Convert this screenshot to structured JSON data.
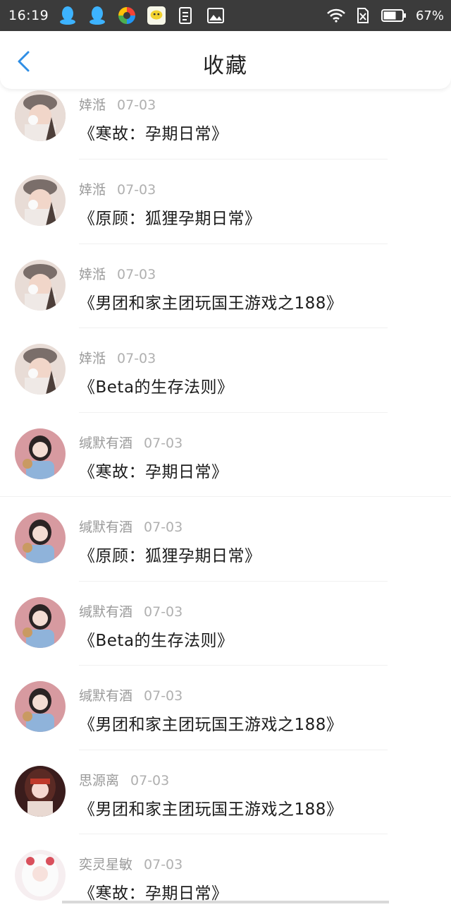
{
  "status": {
    "time": "16:19",
    "battery": "67%"
  },
  "header": {
    "title": "收藏"
  },
  "items": [
    {
      "author": "婞湉",
      "date": "07-03",
      "title": "《寒故：孕期日常》",
      "avatar": "girl-hat"
    },
    {
      "author": "婞湉",
      "date": "07-03",
      "title": "《原顾：狐狸孕期日常》",
      "avatar": "girl-hat"
    },
    {
      "author": "婞湉",
      "date": "07-03",
      "title": "《男团和家主团玩国王游戏之188》",
      "avatar": "girl-hat"
    },
    {
      "author": "婞湉",
      "date": "07-03",
      "title": "《Beta的生存法则》",
      "avatar": "girl-hat"
    },
    {
      "author": "缄默有酒",
      "date": "07-03",
      "title": "《寒故：孕期日常》",
      "avatar": "girl-cat"
    },
    {
      "author": "缄默有酒",
      "date": "07-03",
      "title": "《原顾：狐狸孕期日常》",
      "avatar": "girl-cat"
    },
    {
      "author": "缄默有酒",
      "date": "07-03",
      "title": "《Beta的生存法则》",
      "avatar": "girl-cat"
    },
    {
      "author": "缄默有酒",
      "date": "07-03",
      "title": "《男团和家主团玩国王游戏之188》",
      "avatar": "girl-cat"
    },
    {
      "author": "思源离",
      "date": "07-03",
      "title": "《男团和家主团玩国王游戏之188》",
      "avatar": "anime-girl"
    },
    {
      "author": "奕灵星敏",
      "date": "07-03",
      "title": "《寒故：孕期日常》",
      "avatar": "anime-white"
    }
  ],
  "colors": {
    "accent": "#2f8ee5",
    "status_bar": "#3b3b3b"
  }
}
